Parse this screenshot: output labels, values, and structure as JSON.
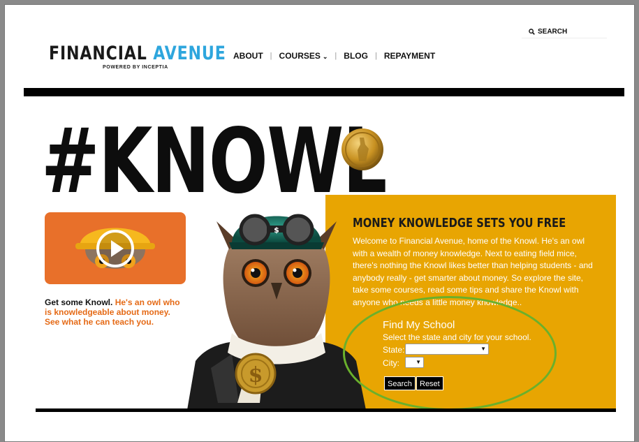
{
  "header": {
    "logo_word1": "FINANCIAL",
    "logo_word2": "AVENUE",
    "logo_tagline": "POWERED BY INCEPTIA",
    "search_label": "SEARCH",
    "nav": [
      {
        "label": "ABOUT"
      },
      {
        "label": "COURSES"
      },
      {
        "label": "BLOG"
      },
      {
        "label": "REPAYMENT"
      }
    ]
  },
  "hero": {
    "hashtag": "#KNOWL"
  },
  "video": {
    "lead": "Get some Knowl.",
    "caption": " He's an owl who is knowledgeable about money. See what he can teach you."
  },
  "panel": {
    "title": "MONEY KNOWLEDGE SETS YOU FREE",
    "body": "Welcome to Financial Avenue, home of the Knowl. He's an owl with a wealth of money knowledge. Next to eating field mice, there's nothing the Knowl likes better than helping students - and anybody really - get smarter about money. So explore the site, take some courses, read some tips and share the Knowl with anyone who needs a little money knowledge..",
    "find": {
      "title": "Find My School",
      "subtitle": "Select the state and city for your school.",
      "state_label": "State:",
      "city_label": "City:",
      "search_button": "Search",
      "reset_button": "Reset"
    }
  },
  "colors": {
    "brand_blue": "#2ea6dd",
    "panel_gold": "#e8a502",
    "video_orange": "#e8702a",
    "highlight_green": "#6ab02c"
  }
}
